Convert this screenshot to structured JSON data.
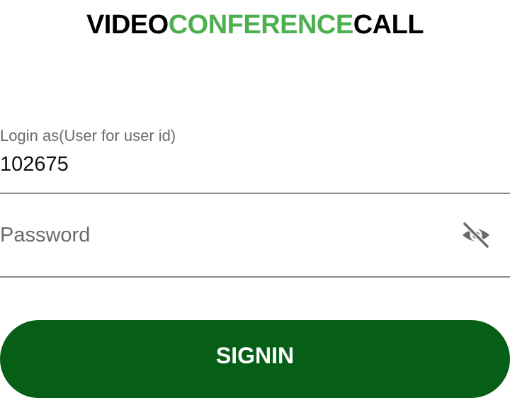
{
  "header": {
    "title_part1": "VIDEO",
    "title_part2": "CONFERENCE",
    "title_part3": "CALL",
    "accent_color": "#4caf50"
  },
  "form": {
    "user_id": {
      "label": "Login as(User for user id)",
      "value": "102675"
    },
    "password": {
      "placeholder": "Password",
      "toggle_icon": "eye-off-icon"
    },
    "signin_label": "SIGNIN",
    "button_color": "#075e17"
  }
}
